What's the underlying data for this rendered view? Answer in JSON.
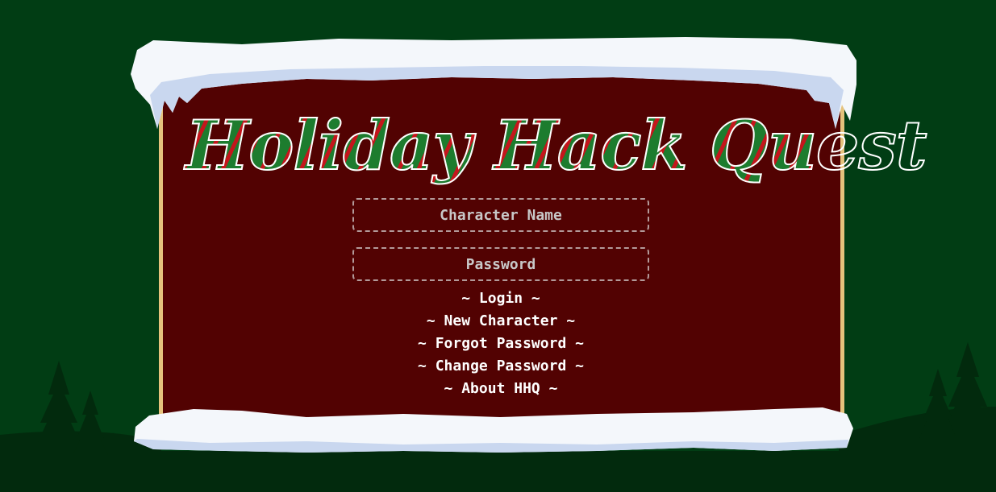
{
  "colors": {
    "background": "#013d14",
    "board": "#520202",
    "board_edge": "#e5c27c",
    "snow": "#f4f7fb",
    "snow_shadow": "#c9d7ef",
    "title_green": "#1d7c2e",
    "title_red": "#c4161c",
    "tree": "#022a0d"
  },
  "title": "Holiday Hack Quest",
  "login_form": {
    "character_name_placeholder": "Character Name",
    "password_placeholder": "Password"
  },
  "menu": {
    "login": "~ Login ~",
    "new_character": "~ New Character ~",
    "forgot_password": "~ Forgot Password ~",
    "change_password": "~ Change Password ~",
    "about": "~ About HHQ ~"
  }
}
